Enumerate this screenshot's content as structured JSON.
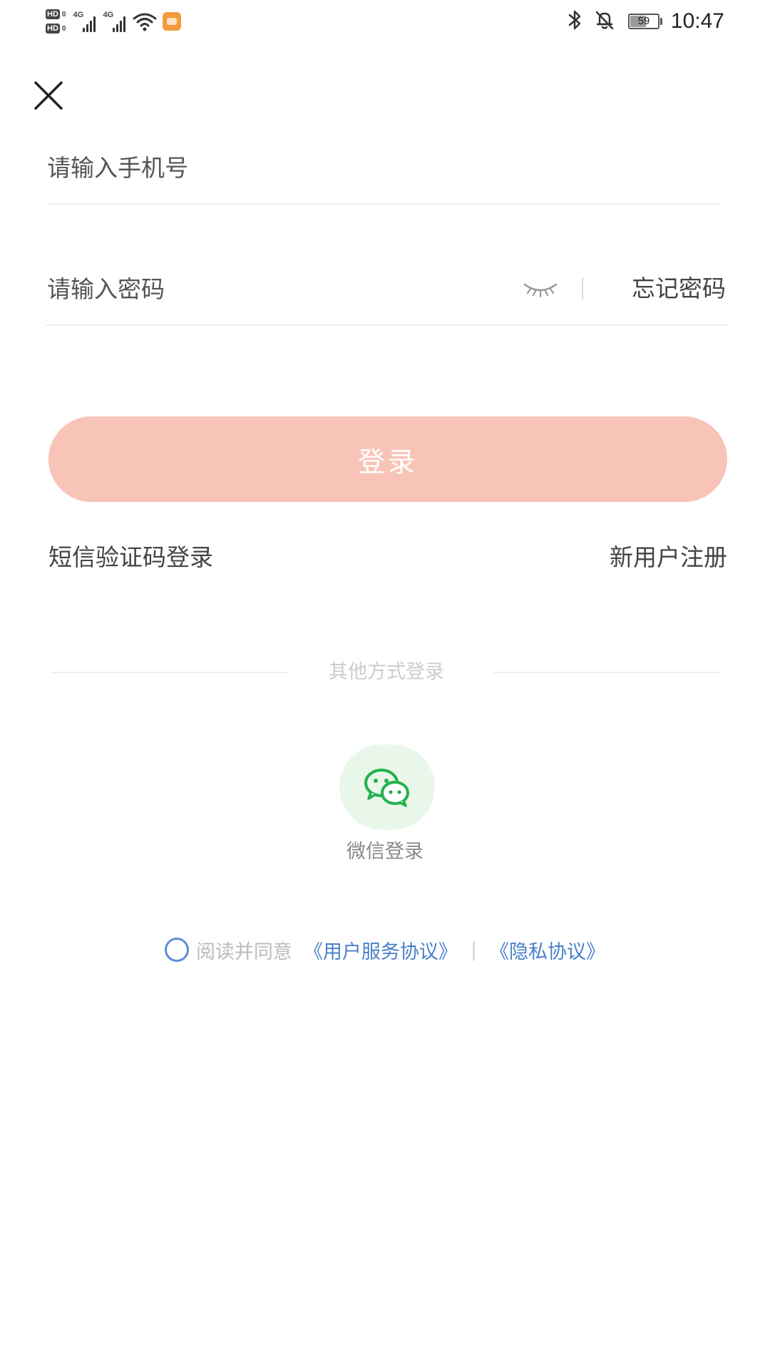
{
  "status_bar": {
    "hd_badge": "HD",
    "hd_sub": "0",
    "signal_label": "4G",
    "time": "10:47",
    "battery_level": "59",
    "battery_percent": 59,
    "icons": [
      "hd-icon",
      "signal-icon",
      "signal-icon",
      "wifi-icon",
      "app-notification-icon",
      "bluetooth-icon",
      "bell-off-icon",
      "battery-icon"
    ]
  },
  "form": {
    "phone_placeholder": "请输入手机号",
    "phone_value": "",
    "password_placeholder": "请输入密码",
    "password_value": "",
    "forgot_password": "忘记密码",
    "login_button": "登录",
    "sms_login": "短信验证码登录",
    "register": "新用户注册"
  },
  "other_login": {
    "divider_label": "其他方式登录",
    "wechat_label": "微信登录"
  },
  "agreement": {
    "prefix": "阅读并同意",
    "user_agreement": "《用户服务协议》",
    "separator": "|",
    "privacy_policy": "《隐私协议》",
    "checked": false
  },
  "colors": {
    "login_button_bg": "#f8c4b8",
    "link_blue": "#4a7fc9",
    "wechat_green": "#22b14c",
    "wechat_bg": "#e9f7ea"
  }
}
